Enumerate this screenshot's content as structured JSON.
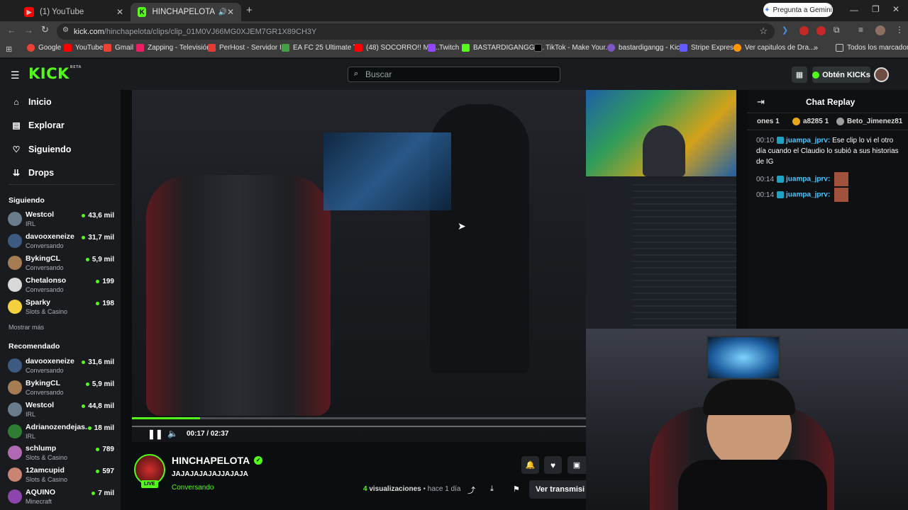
{
  "browser": {
    "tabs": [
      {
        "title": "(1) YouTube",
        "favicon_color": "#ff0000"
      },
      {
        "title": "HINCHAPELOTA - Watch cli",
        "favicon_color": "#53fc18"
      }
    ],
    "new_tab": "+",
    "gemini_button": "Pregunta a Gemini",
    "url_domain": "kick.com",
    "url_path": "/hinchapelota/clips/clip_01M0VJ66MG0XJEM7GR1X89CH3Y",
    "bookmarks": [
      {
        "label": "Google",
        "color": "#ea4335"
      },
      {
        "label": "YouTube",
        "color": "#ff0000"
      },
      {
        "label": "Gmail",
        "color": "#ea4335"
      },
      {
        "label": "Zapping - Televisión...",
        "color": "#e91e63"
      },
      {
        "label": "PerHost - Servidor I...",
        "color": "#e53935"
      },
      {
        "label": "EA FC 25 Ultimate T...",
        "color": "#43a047"
      },
      {
        "label": "(48) SOCORRO!! ME...",
        "color": "#ff0000"
      },
      {
        "label": "Twitch",
        "color": "#9146ff"
      },
      {
        "label": "BASTARDIGANGG |...",
        "color": "#53fc18"
      },
      {
        "label": "TikTok - Make Your...",
        "color": "#000000"
      },
      {
        "label": "bastardigangg - Kic...",
        "color": "#7e57c2"
      },
      {
        "label": "Stripe Express",
        "color": "#635bff"
      },
      {
        "label": "Ver capitulos de Dra...",
        "color": "#ff9800"
      }
    ],
    "all_bookmarks": "Todos los marcadores"
  },
  "kick": {
    "logo": "KICK",
    "logo_badge": "BETA",
    "search_placeholder": "Buscar",
    "get_kicks": "Obtén KICKs",
    "nav": [
      {
        "label": "Inicio",
        "icon": "⌂"
      },
      {
        "label": "Explorar",
        "icon": "▤"
      },
      {
        "label": "Siguiendo",
        "icon": "♡"
      },
      {
        "label": "Drops",
        "icon": "⇊"
      }
    ],
    "following_title": "Siguiendo",
    "following": [
      {
        "name": "Westcol",
        "category": "IRL",
        "viewers": "43,6 mil",
        "color": "#6a7b8c"
      },
      {
        "name": "davooxeneize",
        "category": "Conversando",
        "viewers": "31,7 mil",
        "color": "#3d5a80"
      },
      {
        "name": "BykingCL",
        "category": "Conversando",
        "viewers": "5,9 mil",
        "color": "#a67c52"
      },
      {
        "name": "Chetalonso",
        "category": "Conversando",
        "viewers": "199",
        "color": "#d9d9d9"
      },
      {
        "name": "Sparky",
        "category": "Slots & Casino",
        "viewers": "198",
        "color": "#f4d03f"
      }
    ],
    "show_more": "Mostrar más",
    "recommended_title": "Recomendado",
    "recommended": [
      {
        "name": "davooxeneize",
        "category": "Conversando",
        "viewers": "31,6 mil",
        "color": "#3d5a80"
      },
      {
        "name": "BykingCL",
        "category": "Conversando",
        "viewers": "5,9 mil",
        "color": "#a67c52"
      },
      {
        "name": "Westcol",
        "category": "IRL",
        "viewers": "44,8 mil",
        "color": "#6a7b8c"
      },
      {
        "name": "Adrianozendejas...",
        "category": "IRL",
        "viewers": "18 mil",
        "color": "#2e7d32"
      },
      {
        "name": "schlump",
        "category": "Slots & Casino",
        "viewers": "789",
        "color": "#b06ab3"
      },
      {
        "name": "12amcupid",
        "category": "Slots & Casino",
        "viewers": "597",
        "color": "#c98474"
      },
      {
        "name": "AQUINO",
        "category": "Minecraft",
        "viewers": "7 mil",
        "color": "#8e44ad"
      }
    ]
  },
  "player": {
    "current_time": "00:17",
    "duration": "02:37",
    "progress": 0.15
  },
  "channel": {
    "name": "HINCHAPELOTA",
    "title": "JAJAJAJAJAJJAJAJA",
    "category": "Conversando",
    "live_badge": "LIVE",
    "views_count": "4",
    "views_label": "visualizaciones",
    "age": "• hace 1 día",
    "watch_stream": "Ver transmisi"
  },
  "chat": {
    "title": "Chat Replay",
    "leaderboard": [
      {
        "label": "ones 1"
      },
      {
        "label": "a8285 1"
      },
      {
        "label": "Beto_Jimenez81"
      }
    ],
    "messages": [
      {
        "time": "00:10",
        "user": "juampa_jprv:",
        "text": "Ese clip lo vi el otro día cuando el Claudio lo subió a sus historias de IG"
      },
      {
        "time": "00:14",
        "user": "juampa_jprv:",
        "text": ""
      },
      {
        "time": "00:14",
        "user": "juampa_jprv:",
        "text": ""
      }
    ]
  }
}
